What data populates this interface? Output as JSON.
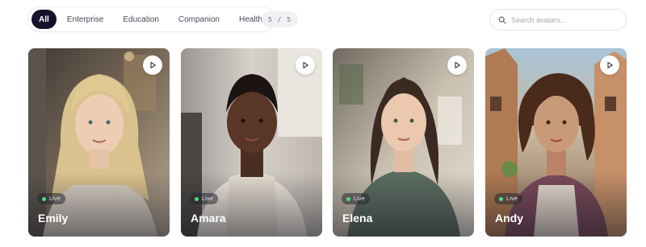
{
  "filters": [
    {
      "label": "All",
      "active": true
    },
    {
      "label": "Enterprise",
      "active": false
    },
    {
      "label": "Education",
      "active": false
    },
    {
      "label": "Companion",
      "active": false
    },
    {
      "label": "Health",
      "active": false
    }
  ],
  "counter": "5 / 5",
  "search": {
    "placeholder": "Search avatars...",
    "icon": "search-icon"
  },
  "colors": {
    "accent": "#15132b",
    "live_dot": "#4ade80"
  },
  "avatars": [
    {
      "name": "Emily",
      "status": "Live",
      "icon": "play-icon"
    },
    {
      "name": "Amara",
      "status": "Live",
      "icon": "play-icon"
    },
    {
      "name": "Elena",
      "status": "Live",
      "icon": "play-icon"
    },
    {
      "name": "Andy",
      "status": "Live",
      "icon": "play-icon"
    }
  ]
}
